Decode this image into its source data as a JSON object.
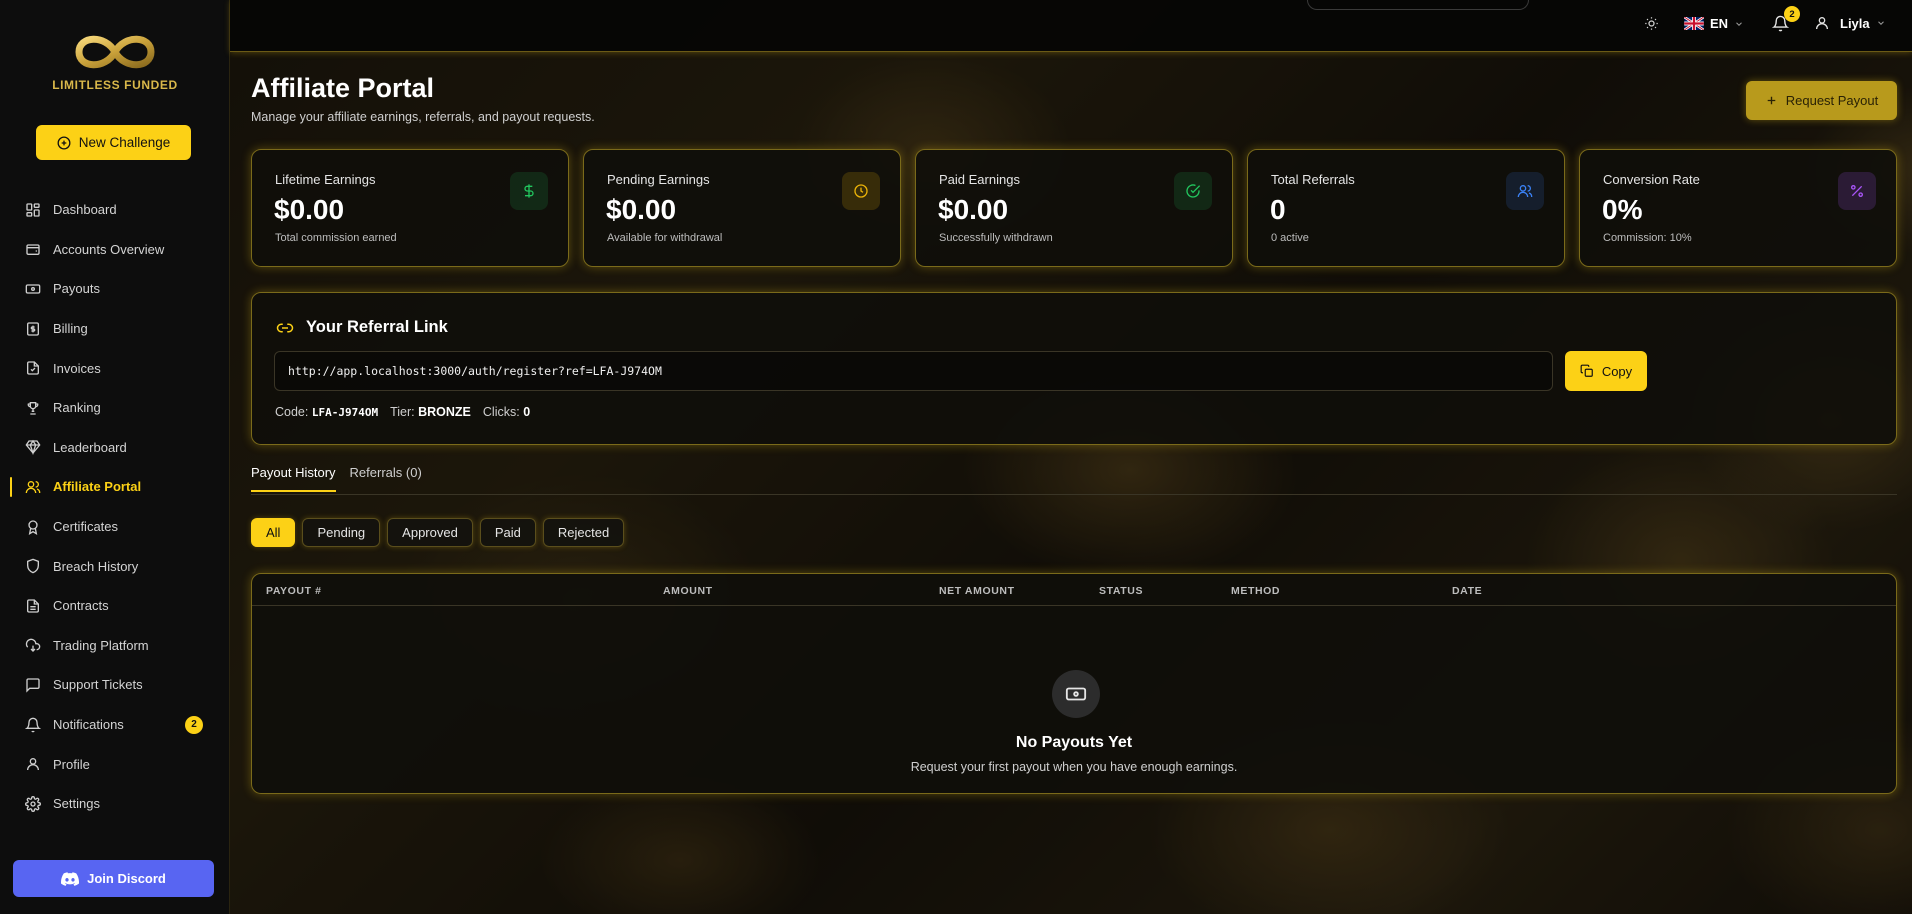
{
  "brand": {
    "name": "LIMITLESS FUNDED",
    "accent": "#fcd116"
  },
  "sidebar": {
    "new_challenge_label": "New Challenge",
    "items": [
      {
        "label": "Dashboard",
        "icon": "grid-icon"
      },
      {
        "label": "Accounts Overview",
        "icon": "wallet-icon"
      },
      {
        "label": "Payouts",
        "icon": "banknote-icon"
      },
      {
        "label": "Billing",
        "icon": "receipt-icon"
      },
      {
        "label": "Invoices",
        "icon": "file-icon"
      },
      {
        "label": "Ranking",
        "icon": "trophy-icon"
      },
      {
        "label": "Leaderboard",
        "icon": "gem-icon"
      },
      {
        "label": "Affiliate Portal",
        "icon": "users-icon",
        "active": true
      },
      {
        "label": "Certificates",
        "icon": "award-icon"
      },
      {
        "label": "Breach History",
        "icon": "shield-icon"
      },
      {
        "label": "Contracts",
        "icon": "document-icon"
      },
      {
        "label": "Trading Platform",
        "icon": "cloud-icon"
      },
      {
        "label": "Support Tickets",
        "icon": "message-icon"
      },
      {
        "label": "Notifications",
        "icon": "bell-icon",
        "badge": "2"
      },
      {
        "label": "Profile",
        "icon": "user-icon"
      },
      {
        "label": "Settings",
        "icon": "gear-icon"
      }
    ],
    "discord_label": "Join Discord"
  },
  "topbar": {
    "language": "EN",
    "notification_count": "2",
    "user_name": "Liyla"
  },
  "page": {
    "title": "Affiliate Portal",
    "subtitle": "Manage your affiliate earnings, referrals, and payout requests.",
    "request_payout_label": "Request Payout"
  },
  "stats": [
    {
      "label": "Lifetime Earnings",
      "value": "$0.00",
      "sub": "Total commission earned",
      "icon": "dollar-icon",
      "color": "#22c55e"
    },
    {
      "label": "Pending Earnings",
      "value": "$0.00",
      "sub": "Available for withdrawal",
      "icon": "clock-icon",
      "color": "#eab308"
    },
    {
      "label": "Paid Earnings",
      "value": "$0.00",
      "sub": "Successfully withdrawn",
      "icon": "check-circle-icon",
      "color": "#22c55e"
    },
    {
      "label": "Total Referrals",
      "value": "0",
      "sub": "0 active",
      "icon": "users-icon",
      "color": "#3b82f6"
    },
    {
      "label": "Conversion Rate",
      "value": "0%",
      "sub": "Commission: 10%",
      "icon": "percent-icon",
      "color": "#a855f7"
    }
  ],
  "referral": {
    "title": "Your Referral Link",
    "link": "http://app.localhost:3000/auth/register?ref=LFA-J974OM",
    "copy_label": "Copy",
    "code_label": "Code:",
    "code": "LFA-J974OM",
    "tier_label": "Tier:",
    "tier": "BRONZE",
    "clicks_label": "Clicks:",
    "clicks": "0"
  },
  "tabs": [
    {
      "label": "Payout History",
      "active": true
    },
    {
      "label": "Referrals (0)"
    }
  ],
  "filters": [
    "All",
    "Pending",
    "Approved",
    "Paid",
    "Rejected"
  ],
  "table": {
    "columns": [
      "PAYOUT #",
      "AMOUNT",
      "NET AMOUNT",
      "STATUS",
      "METHOD",
      "DATE"
    ],
    "empty_title": "No Payouts Yet",
    "empty_sub": "Request your first payout when you have enough earnings."
  }
}
